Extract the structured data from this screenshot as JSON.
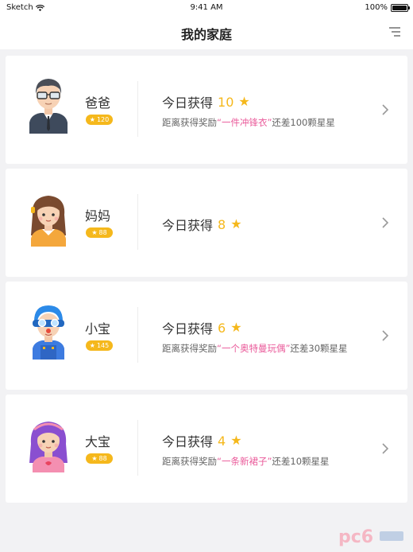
{
  "status_bar": {
    "carrier": "Sketch",
    "time": "9:41 AM",
    "battery": "100%"
  },
  "nav": {
    "title": "我的家庭",
    "menu_icon": "list-menu-icon"
  },
  "members": [
    {
      "name": "爸爸",
      "badge": "120",
      "today_label": "今日获得",
      "today_count": "10",
      "reward_prefix": "距离获得奖励",
      "reward_item": "“一件冲锋衣”",
      "reward_suffix": "还差100颗星星",
      "avatar": "dad-avatar"
    },
    {
      "name": "妈妈",
      "badge": "88",
      "today_label": "今日获得",
      "today_count": "8",
      "reward_prefix": "",
      "reward_item": "",
      "reward_suffix": "",
      "avatar": "mom-avatar"
    },
    {
      "name": "小宝",
      "badge": "145",
      "today_label": "今日获得",
      "today_count": "6",
      "reward_prefix": "距离获得奖励",
      "reward_item": "“一个奥特曼玩偶”",
      "reward_suffix": "还差30颗星星",
      "avatar": "boy-avatar"
    },
    {
      "name": "大宝",
      "badge": "88",
      "today_label": "今日获得",
      "today_count": "4",
      "reward_prefix": "距离获得奖励",
      "reward_item": "“一条新裙子”",
      "reward_suffix": "还差10颗星星",
      "avatar": "girl-avatar"
    }
  ],
  "colors": {
    "accent": "#f5b81c",
    "highlight": "#ea5a9a",
    "background": "#f2f2f4"
  },
  "watermark": "pc6"
}
